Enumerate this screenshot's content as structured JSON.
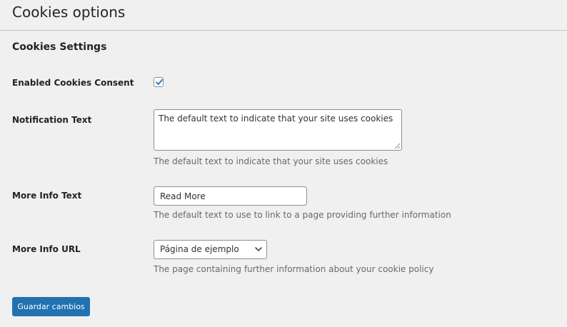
{
  "page": {
    "title": "Cookies options",
    "section_title": "Cookies Settings"
  },
  "fields": {
    "enabled": {
      "label": "Enabled Cookies Consent",
      "checked": true
    },
    "notification_text": {
      "label": "Notification Text",
      "value": "The default text to indicate that your site uses cookies",
      "description": "The default text to indicate that your site uses cookies"
    },
    "more_info_text": {
      "label": "More Info Text",
      "value": "Read More",
      "description": "The default text to use to link to a page providing further information"
    },
    "more_info_url": {
      "label": "More Info URL",
      "selected": "Página de ejemplo",
      "description": "The page containing further information about your cookie policy"
    }
  },
  "actions": {
    "save_label": "Guardar cambios"
  },
  "colors": {
    "accent": "#2271b1",
    "background": "#f0f0f1"
  },
  "icons": {
    "check": "checkmark-icon",
    "select": "chevron-down-icon",
    "grip": "resize-grip-icon"
  }
}
